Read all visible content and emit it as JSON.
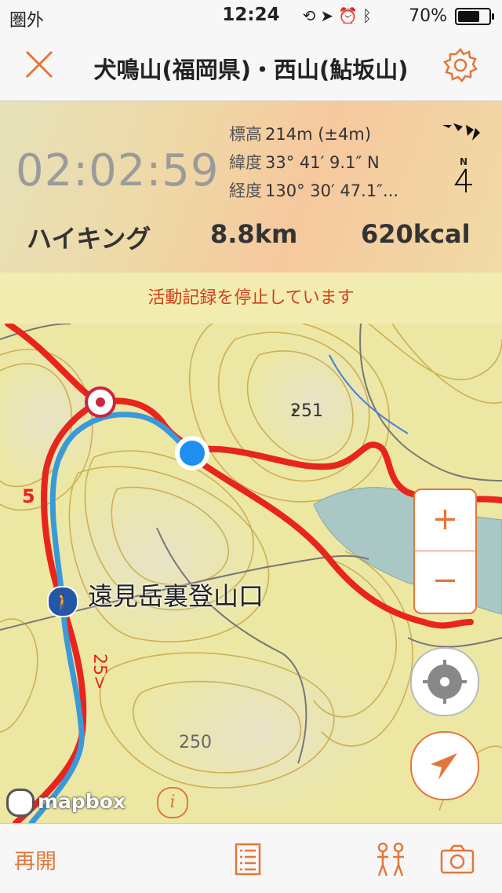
{
  "status_bar": {
    "carrier": "圏外",
    "time": "12:24",
    "battery": "70%",
    "battery_level": 0.7
  },
  "nav": {
    "title": "犬鳴山(福岡県)・西山(鮎坂山)"
  },
  "tracking": {
    "timer": "02:02:59",
    "elevation_label": "標高",
    "elevation": "214m (±4m)",
    "latitude_label": "緯度",
    "latitude": "33° 41′ 9.1″ N",
    "longitude_label": "経度",
    "longitude": "130° 30′ 47.1″...",
    "compass_north": "N",
    "activity": "ハイキング",
    "distance": "8.8km",
    "calories": "620kcal"
  },
  "notice": "活動記録を停止しています",
  "map": {
    "place_label": "遠見岳裏登山口",
    "contour_label_1": "251",
    "contour_label_2": "250",
    "route_label_1": "5",
    "route_label_2": "25>",
    "attribution": "mapbox",
    "info": "i",
    "zoom_in": "+",
    "zoom_out": "−"
  },
  "toolbar": {
    "resume": "再開"
  },
  "colors": {
    "accent": "#e3773a",
    "notice_text": "#d0401c",
    "route_red": "#e8251c",
    "track_blue": "#3a9ad9"
  }
}
